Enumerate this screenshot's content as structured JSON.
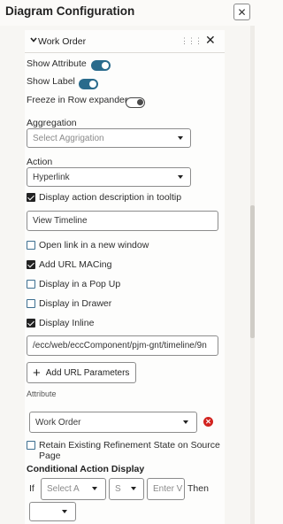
{
  "header": {
    "title": "Diagram Configuration",
    "close_icon": "close-icon"
  },
  "section": {
    "title": "Work Order",
    "collapse_icon": "chevron-down-icon",
    "drag_icon": "drag-handle-icon",
    "remove_icon": "close-icon"
  },
  "toggles": {
    "show_attribute": {
      "label": "Show Attribute",
      "on": true
    },
    "show_label": {
      "label": "Show Label",
      "on": true
    },
    "freeze": {
      "label": "Freeze in Row expander",
      "on": false
    }
  },
  "aggregation": {
    "label": "Aggregation",
    "placeholder": "Select Aggrigation"
  },
  "action": {
    "label": "Action",
    "value": "Hyperlink"
  },
  "checkbox_display_desc": {
    "label": "Display action description in tooltip",
    "checked": true
  },
  "tooltip_text": {
    "value": "View Timeline"
  },
  "checkbox_open_new": {
    "label": "Open link in a new window",
    "checked": false
  },
  "checkbox_add_url": {
    "label": "Add URL MACing",
    "checked": true
  },
  "checkbox_popup": {
    "label": "Display in a Pop Up",
    "checked": false
  },
  "checkbox_drawer": {
    "label": "Display in Drawer",
    "checked": false
  },
  "checkbox_inline": {
    "label": "Display Inline",
    "checked": true
  },
  "url": {
    "value": "/ecc/web/eccComponent/pjm-gnt/timeline/9n"
  },
  "add_params_button": {
    "label": "Add URL Parameters"
  },
  "attribute": {
    "label": "Attribute",
    "value": "Work Order"
  },
  "checkbox_retain": {
    "label_line1": "Retain Existing Refinement State on Source",
    "label_line2": "Page",
    "checked": false
  },
  "conditional": {
    "label": "Conditional Action Display",
    "if_label": "If",
    "select_attr_placeholder": "Select A",
    "select_op_placeholder": "S",
    "enter_value_placeholder": "Enter V",
    "then_label": "Then"
  }
}
